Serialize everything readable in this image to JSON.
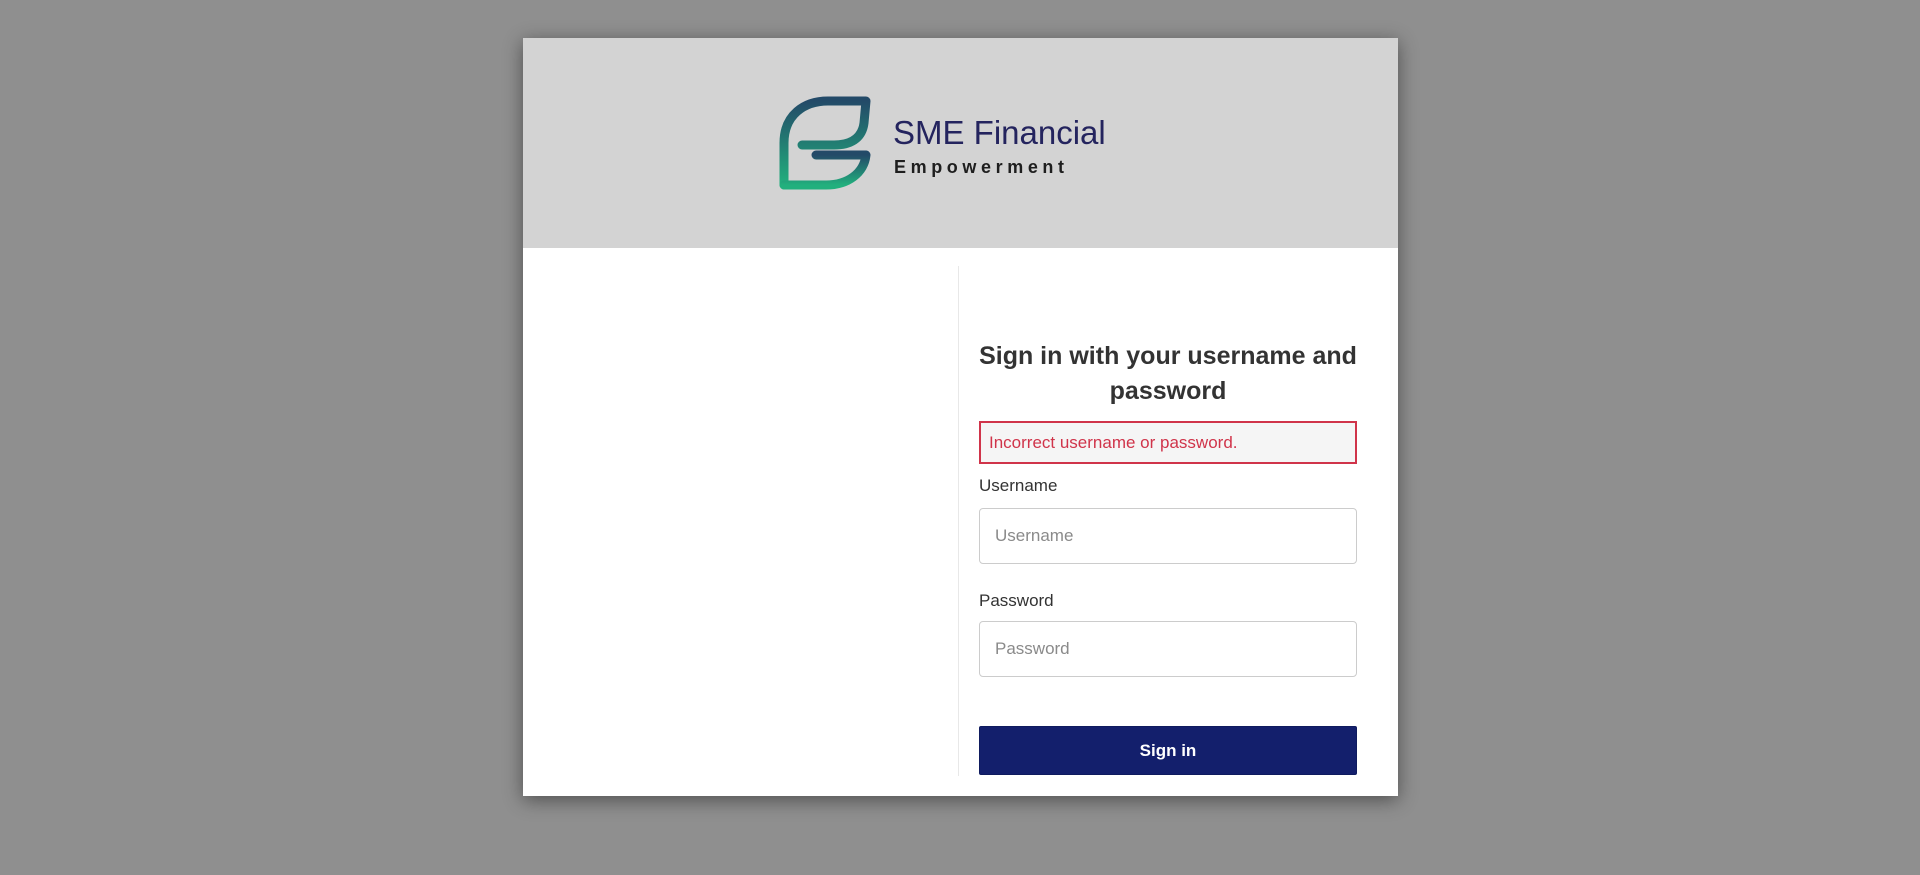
{
  "brand": {
    "name_line1": "SME Financial",
    "name_line2": "Empowerment",
    "logo_icon": "leaf-e-logo",
    "colors": {
      "name": "#24245e",
      "tagline": "#1e1e1e",
      "logo_gradient_top": "#234a68",
      "logo_gradient_bottom": "#22b07d"
    }
  },
  "form": {
    "title": "Sign in with your username and password",
    "error_message": "Incorrect username or password.",
    "username": {
      "label": "Username",
      "placeholder": "Username",
      "value": ""
    },
    "password": {
      "label": "Password",
      "placeholder": "Password",
      "value": ""
    },
    "submit_label": "Sign in"
  },
  "theme": {
    "backdrop": "#8f8f8f",
    "banner": "#d3d3d3",
    "primary_button": "#131f6c",
    "error": "#d0344a"
  }
}
